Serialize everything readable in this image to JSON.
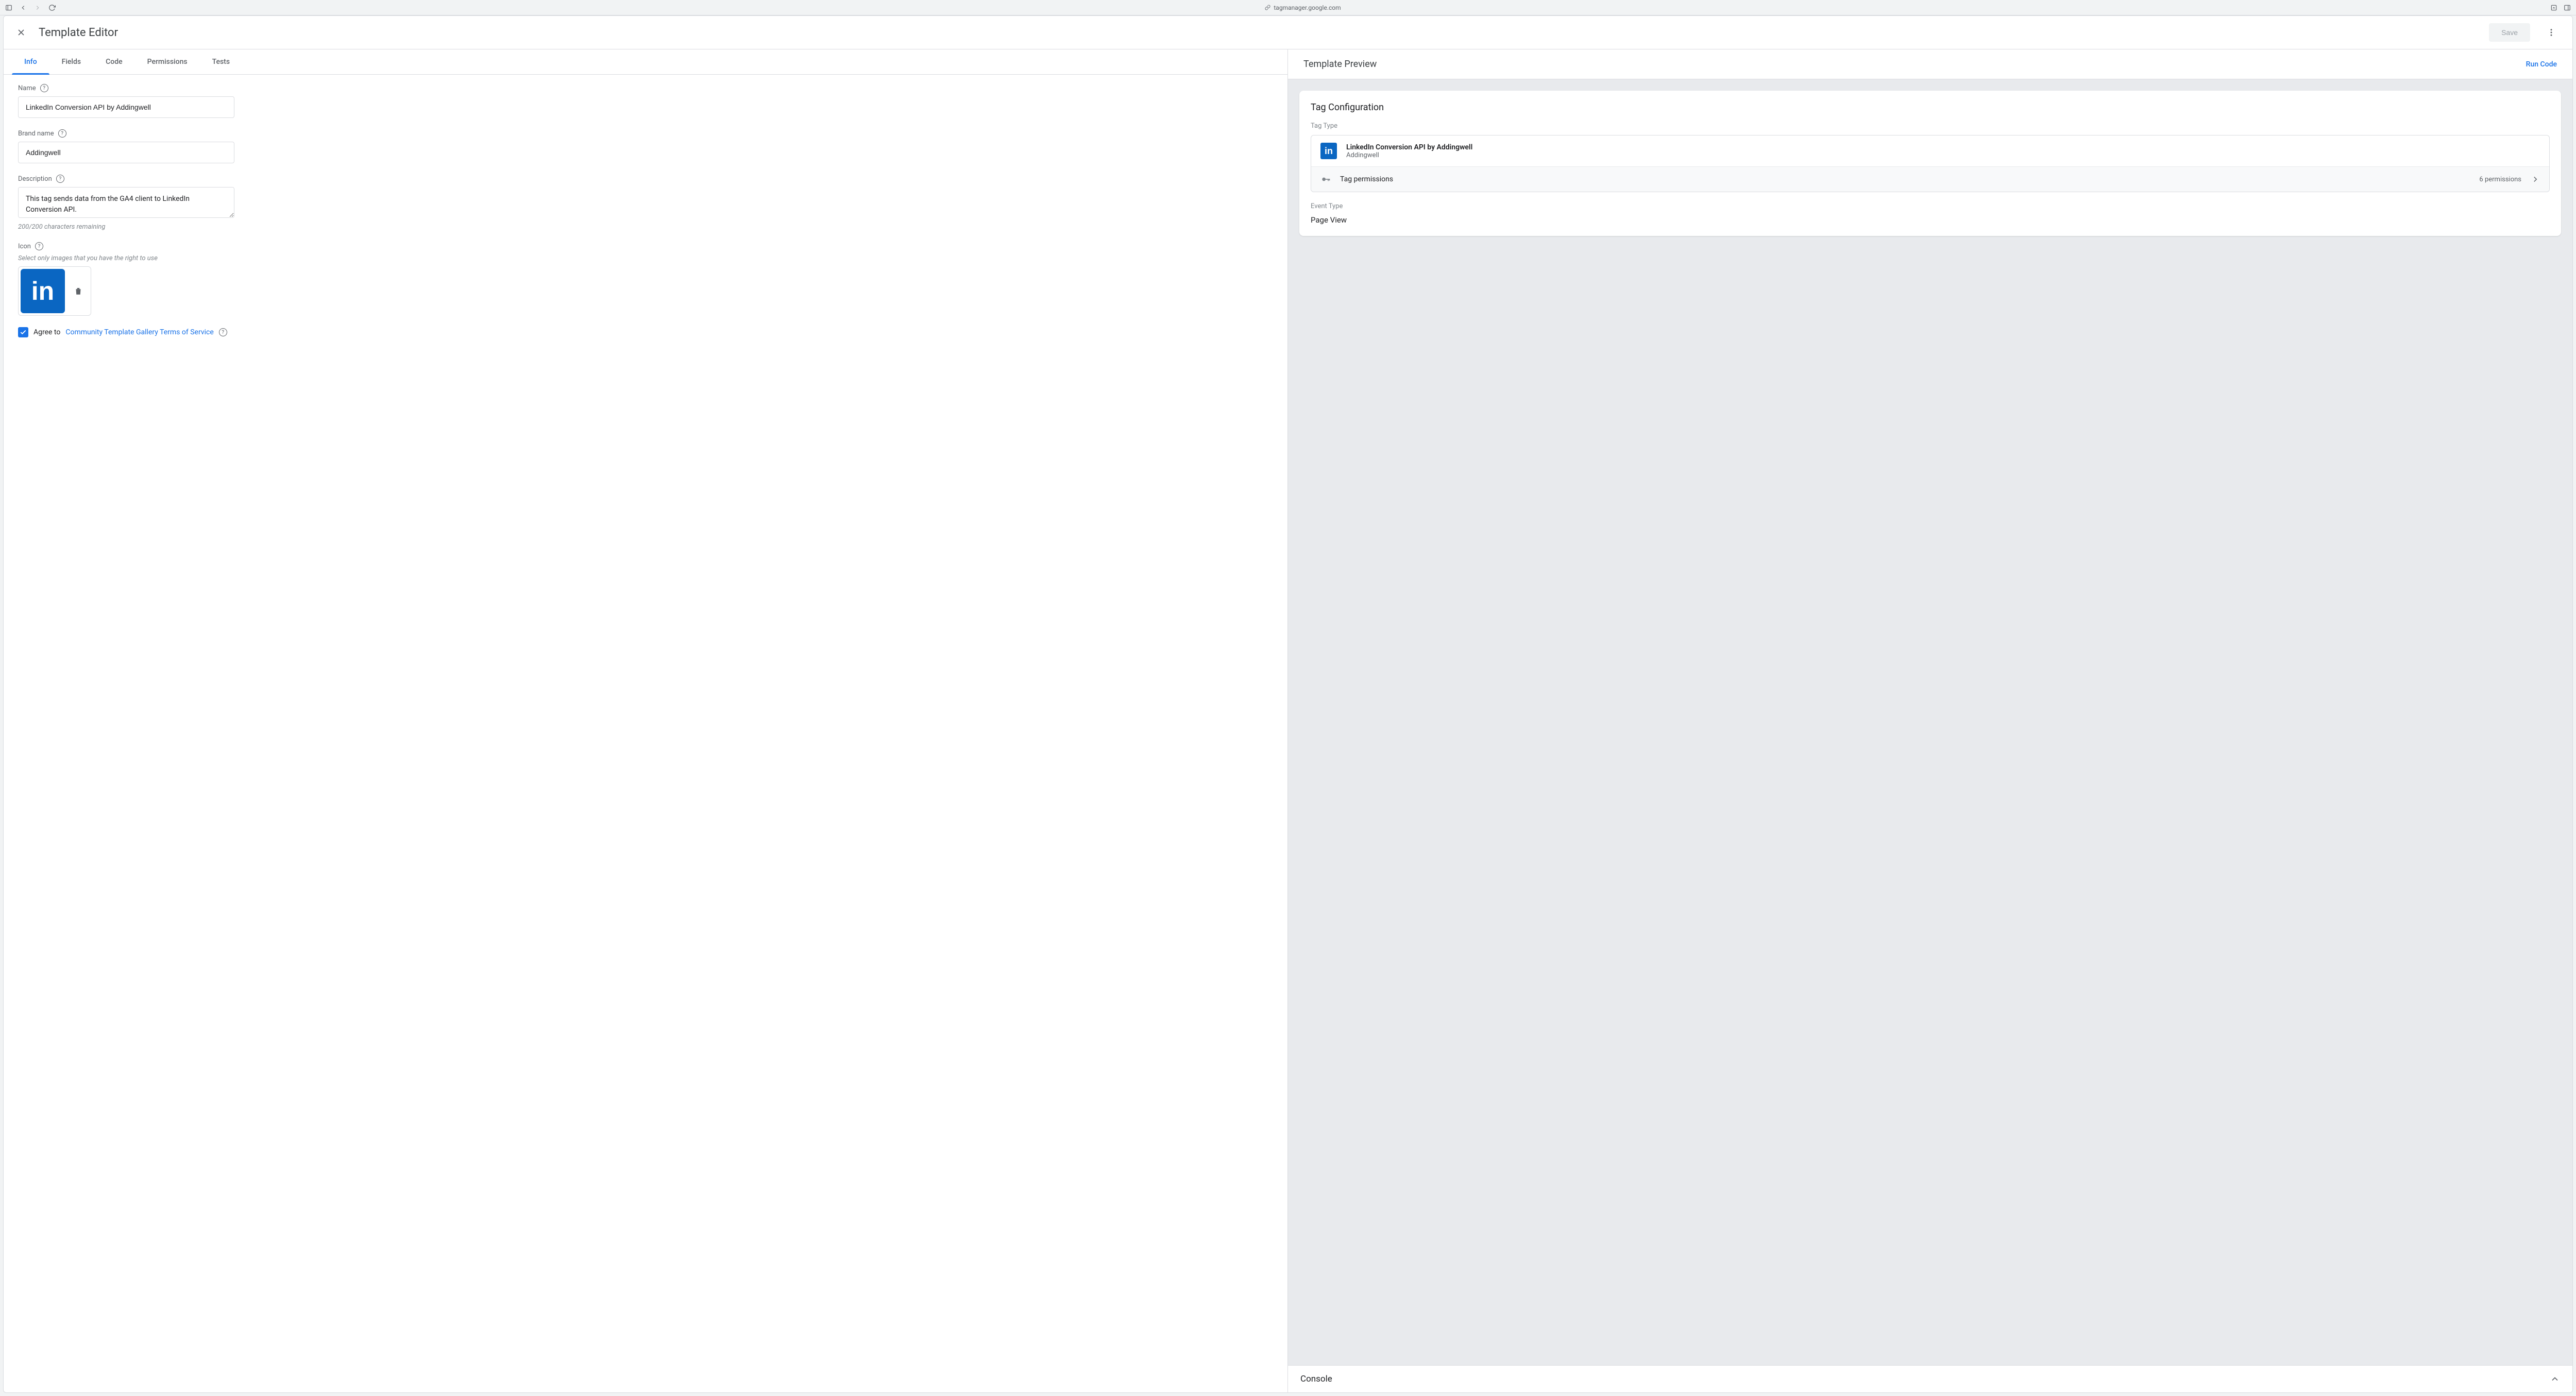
{
  "browser": {
    "url": "tagmanager.google.com"
  },
  "header": {
    "title": "Template Editor",
    "save_label": "Save"
  },
  "tabs": [
    "Info",
    "Fields",
    "Code",
    "Permissions",
    "Tests"
  ],
  "active_tab": "Info",
  "form": {
    "name": {
      "label": "Name",
      "value": "LinkedIn Conversion API by Addingwell"
    },
    "brand": {
      "label": "Brand name",
      "value": "Addingwell"
    },
    "description": {
      "label": "Description",
      "value": "This tag sends data from the GA4 client to LinkedIn Conversion API.",
      "helper": "200/200 characters remaining"
    },
    "icon": {
      "label": "Icon",
      "hint": "Select only images that you have the right to use",
      "glyph": "in"
    },
    "agree": {
      "prefix": "Agree to ",
      "link": "Community Template Gallery Terms of Service",
      "checked": true
    }
  },
  "preview": {
    "title": "Template Preview",
    "run_label": "Run Code",
    "card_title": "Tag Configuration",
    "tag_type_label": "Tag Type",
    "tag_name": "LinkedIn Conversion API by Addingwell",
    "tag_brand": "Addingwell",
    "permissions_label": "Tag permissions",
    "permissions_count": "6 permissions",
    "event_type_label": "Event Type",
    "event_type_value": "Page View"
  },
  "console": {
    "title": "Console"
  }
}
